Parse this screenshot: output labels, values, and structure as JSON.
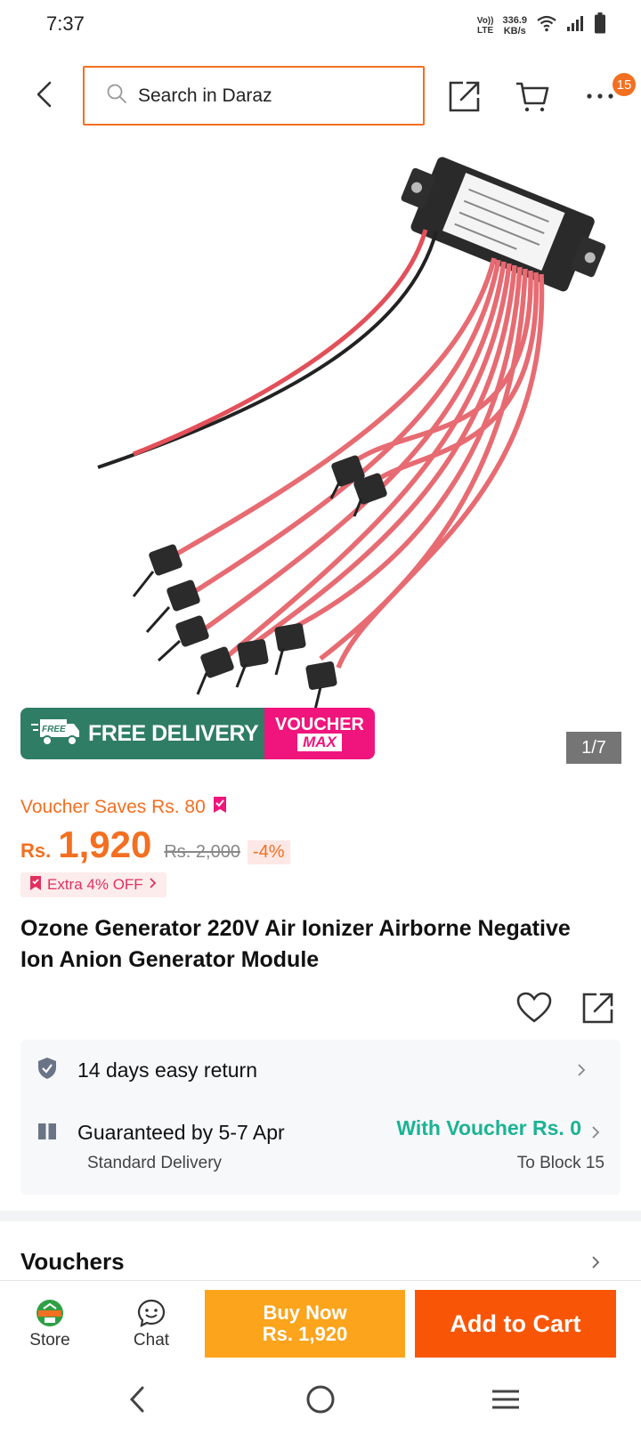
{
  "status_bar": {
    "time": "7:37",
    "volte_top": "Vo))",
    "volte_bottom": "LTE",
    "speed_value": "336.9",
    "speed_unit": "KB/s",
    "icons": [
      "wifi-icon",
      "signal-icon",
      "battery-icon"
    ]
  },
  "header": {
    "search_placeholder": "Search in Daraz",
    "cart_badge": "15",
    "icons": [
      "back-arrow-icon",
      "search-icon",
      "share-icon",
      "cart-icon",
      "more-icon"
    ]
  },
  "gallery": {
    "counter": "1/7",
    "promo_free_badge": "FREE",
    "promo_free_label": "FREE DELIVERY",
    "promo_voucher_line1": "VOUCHER",
    "promo_voucher_line2": "MAX"
  },
  "pricing": {
    "voucher_saves": "Voucher Saves Rs. 80",
    "currency": "Rs.",
    "price": "1,920",
    "original_price": "Rs. 2,000",
    "discount": "-4%",
    "extra_off": "Extra 4% OFF"
  },
  "product": {
    "title": "Ozone Generator 220V Air Ionizer Airborne Negative Ion Anion Generator Module"
  },
  "info": {
    "return_text": "14 days easy return",
    "delivery_text": "Guaranteed by 5-7 Apr",
    "delivery_voucher": "With Voucher Rs. 0",
    "delivery_type": "Standard Delivery",
    "delivery_location": "To Block 15"
  },
  "sections": {
    "vouchers_title": "Vouchers"
  },
  "action_bar": {
    "store_label": "Store",
    "chat_label": "Chat",
    "buy_now_line1": "Buy Now",
    "buy_now_line2": "Rs. 1,920",
    "add_to_cart": "Add to Cart"
  },
  "colors": {
    "brand_orange": "#f85606",
    "price_orange": "#f36f21",
    "buy_now_yellow": "#fba41c",
    "free_delivery_green": "#2f7d65",
    "voucher_pink": "#f0157c",
    "voucher_teal": "#1bb394"
  }
}
